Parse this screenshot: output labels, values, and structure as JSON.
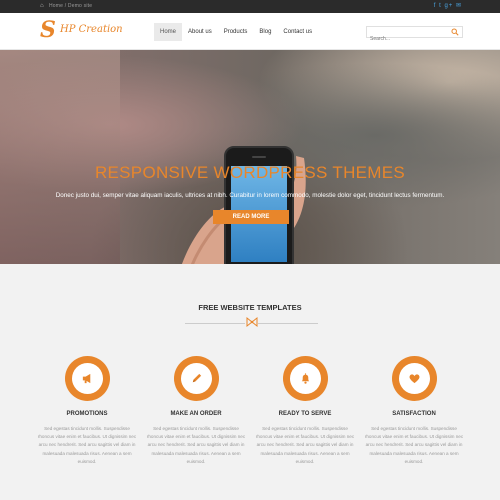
{
  "topbar": {
    "breadcrumb": "Home / Demo site",
    "social": "f t g+ ✉"
  },
  "header": {
    "logo_letter": "S",
    "logo_text": "HP Creation",
    "nav": [
      "Home",
      "About us",
      "Products",
      "Blog",
      "Contact us"
    ],
    "search_placeholder": "Search..."
  },
  "hero": {
    "title": "RESPONSIVE WORDPRESS THEMES",
    "subtitle": "Donec justo dui, semper vitae aliquam iaculis, ultrices at nibh. Curabitur in lorem commodo, molestie dolor eget, tincidunt lectus fermentum.",
    "button": "READ MORE"
  },
  "section": {
    "title": "FREE WEBSITE TEMPLATES",
    "features": [
      {
        "title": "PROMOTIONS",
        "icon": "megaphone-icon",
        "text": "Sed egestas tincidunt mollis. Suspendisse rhoncus vitae enim et faucibus. Ut dignissim nec arcu nec hendrerit. Sed arcu sagittis vel diam in malesuada malesuada risus. Aenean a sem euismod."
      },
      {
        "title": "MAKE AN ORDER",
        "icon": "pencil-icon",
        "text": "Sed egestas tincidunt mollis. Suspendisse rhoncus vitae enim et faucibus. Ut dignissim nec arcu nec hendrerit. Sed arcu sagittis vel diam in malesuada malesuada risus. Aenean a sem euismod."
      },
      {
        "title": "READY TO SERVE",
        "icon": "bell-icon",
        "text": "Sed egestas tincidunt mollis. Suspendisse rhoncus vitae enim et faucibus. Ut dignissim nec arcu nec hendrerit. Sed arcu sagittis vel diam in malesuada malesuada risus. Aenean a sem euismod."
      },
      {
        "title": "SATISFACTION",
        "icon": "heart-icon",
        "text": "Sed egestas tincidunt mollis. Suspendisse rhoncus vitae enim et faucibus. Ut dignissim nec arcu nec hendrerit. Sed arcu sagittis vel diam in malesuada malesuada risus. Aenean a sem euismod."
      }
    ]
  },
  "colors": {
    "accent": "#e8862b",
    "topbar": "#2b2b2b",
    "page_bg": "#f2f2f2"
  }
}
